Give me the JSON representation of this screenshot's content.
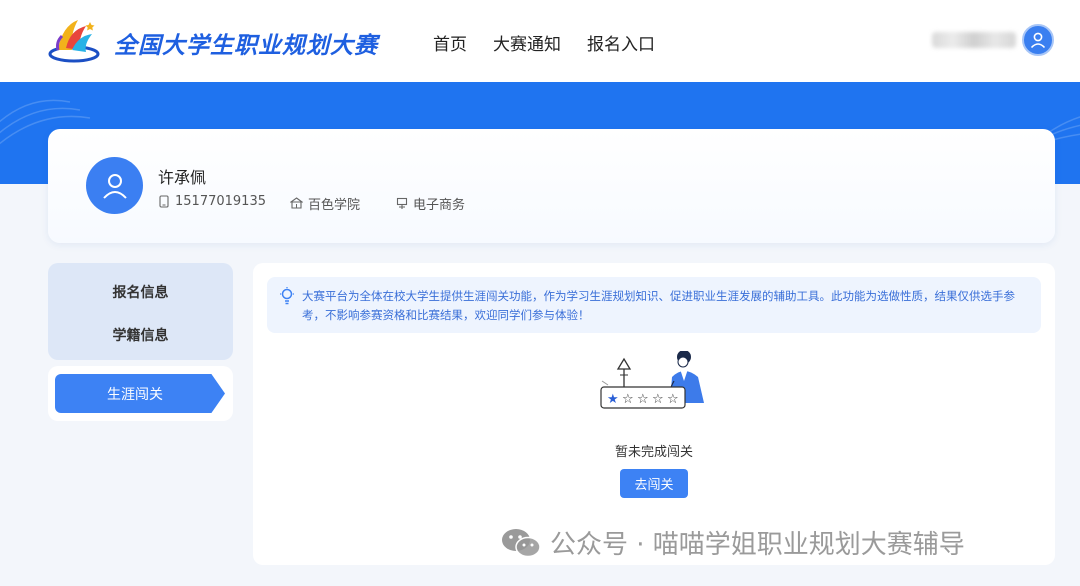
{
  "header": {
    "brand": "全国大学生职业规划大赛",
    "nav": [
      "首页",
      "大赛通知",
      "报名入口"
    ]
  },
  "profile": {
    "name": "许承佩",
    "phone": "15177019135",
    "school": "百色学院",
    "major": "电子商务"
  },
  "menu": {
    "items": [
      "报名信息",
      "学籍信息"
    ],
    "active": "生涯闯关"
  },
  "main": {
    "notice": "大赛平台为全体在校大学生提供生涯闯关功能，作为学习生涯规划知识、促进职业生涯发展的辅助工具。此功能为选做性质，结果仅供选手参考，不影响参赛资格和比赛结果，欢迎同学们参与体验！",
    "empty_text": "暂未完成闯关",
    "button": "去闯关"
  },
  "watermark": "公众号 · 喵喵学姐职业规划大赛辅导",
  "colors": {
    "primary": "#1f74f0",
    "accent": "#3d82f4",
    "brand_text": "#1e5fe0",
    "notice_bg": "#eef4fe"
  }
}
